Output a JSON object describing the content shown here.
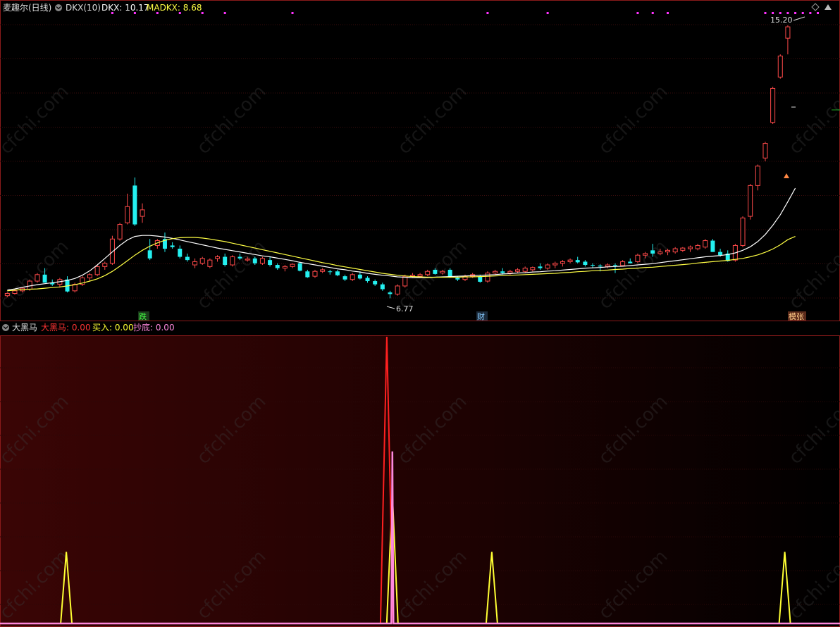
{
  "colors": {
    "up": "#ff4a4a",
    "down": "#24f0f0",
    "ma1": "#ffffff",
    "ma2": "#ffff44",
    "dahema": "#ff2020",
    "buy": "#ffff33",
    "chaodi": "#ff88dd",
    "dots": "#ff33ff",
    "bg_top": "#000000",
    "frame": "#8b1a1a",
    "grid": "#3a0d0d",
    "label": "#cccccc"
  },
  "header": {
    "stock_name": "麦趣尔(日线)",
    "indicator": "DKX(10)",
    "dkx_label": "DKX: 10.17",
    "madkx_label": "MADKX: 8.68"
  },
  "lower_header": {
    "name": "大黑马",
    "v1": "大黑马: 0.00",
    "v2": "买入: 0.00",
    "v3": "抄底: 0.00"
  },
  "annotations": {
    "high": "15.20",
    "low": "6.77",
    "tag1": "跌",
    "tag2": "财",
    "tag3": "模张"
  },
  "chart_data": [
    {
      "type": "candlestick",
      "ylim": [
        6.3,
        15.5
      ],
      "candles": [
        [
          6.85,
          6.95,
          6.8,
          6.92
        ],
        [
          6.92,
          7.05,
          6.88,
          7.0
        ],
        [
          7.0,
          7.1,
          6.95,
          7.08
        ],
        [
          7.05,
          7.35,
          7.0,
          7.3
        ],
        [
          7.3,
          7.55,
          7.25,
          7.5
        ],
        [
          7.5,
          7.7,
          7.4,
          7.25
        ],
        [
          7.25,
          7.35,
          7.15,
          7.2
        ],
        [
          7.2,
          7.4,
          7.1,
          7.35
        ],
        [
          7.35,
          7.45,
          6.95,
          6.98
        ],
        [
          7.0,
          7.25,
          6.95,
          7.2
        ],
        [
          7.2,
          7.45,
          7.15,
          7.4
        ],
        [
          7.4,
          7.55,
          7.3,
          7.5
        ],
        [
          7.5,
          7.8,
          7.45,
          7.75
        ],
        [
          7.75,
          7.9,
          7.65,
          7.85
        ],
        [
          7.85,
          8.7,
          7.8,
          8.6
        ],
        [
          8.6,
          9.1,
          8.55,
          9.05
        ],
        [
          9.1,
          10.0,
          9.05,
          9.6
        ],
        [
          10.25,
          10.5,
          9.0,
          9.05
        ],
        [
          9.3,
          9.7,
          9.1,
          9.5
        ],
        [
          8.25,
          8.6,
          7.95,
          8.0
        ],
        [
          8.4,
          8.6,
          8.3,
          8.55
        ],
        [
          8.6,
          8.8,
          8.2,
          8.3
        ],
        [
          8.4,
          8.5,
          8.3,
          8.35
        ],
        [
          8.3,
          8.4,
          8.0,
          8.05
        ],
        [
          8.05,
          8.15,
          7.9,
          7.95
        ],
        [
          7.8,
          8.0,
          7.7,
          7.9
        ],
        [
          7.85,
          8.05,
          7.8,
          8.0
        ],
        [
          7.75,
          8.0,
          7.7,
          7.95
        ],
        [
          8.0,
          8.1,
          7.9,
          8.05
        ],
        [
          8.05,
          8.15,
          7.75,
          7.8
        ],
        [
          7.8,
          8.1,
          7.75,
          8.05
        ],
        [
          8.05,
          8.15,
          7.95,
          8.0
        ],
        [
          7.95,
          8.05,
          7.9,
          7.98
        ],
        [
          8.0,
          8.05,
          7.8,
          7.85
        ],
        [
          7.85,
          8.05,
          7.8,
          8.0
        ],
        [
          7.95,
          8.05,
          7.75,
          7.8
        ],
        [
          7.8,
          7.85,
          7.65,
          7.7
        ],
        [
          7.7,
          7.8,
          7.6,
          7.75
        ],
        [
          7.75,
          7.85,
          7.7,
          7.82
        ],
        [
          7.85,
          7.9,
          7.6,
          7.62
        ],
        [
          7.6,
          7.65,
          7.4,
          7.42
        ],
        [
          7.45,
          7.65,
          7.4,
          7.6
        ],
        [
          7.6,
          7.7,
          7.55,
          7.65
        ],
        [
          7.6,
          7.65,
          7.5,
          7.58
        ],
        [
          7.6,
          7.65,
          7.45,
          7.48
        ],
        [
          7.45,
          7.5,
          7.3,
          7.35
        ],
        [
          7.35,
          7.55,
          7.3,
          7.5
        ],
        [
          7.5,
          7.6,
          7.35,
          7.38
        ],
        [
          7.4,
          7.45,
          7.25,
          7.3
        ],
        [
          7.3,
          7.35,
          7.15,
          7.2
        ],
        [
          7.2,
          7.25,
          7.0,
          7.05
        ],
        [
          6.95,
          7.0,
          6.77,
          6.9
        ],
        [
          6.9,
          7.2,
          6.85,
          7.15
        ],
        [
          7.15,
          7.5,
          7.1,
          7.45
        ],
        [
          7.45,
          7.55,
          7.4,
          7.48
        ],
        [
          7.45,
          7.55,
          7.4,
          7.5
        ],
        [
          7.5,
          7.65,
          7.45,
          7.6
        ],
        [
          7.65,
          7.7,
          7.5,
          7.52
        ],
        [
          7.55,
          7.65,
          7.5,
          7.6
        ],
        [
          7.65,
          7.7,
          7.4,
          7.42
        ],
        [
          7.4,
          7.45,
          7.3,
          7.35
        ],
        [
          7.35,
          7.5,
          7.3,
          7.45
        ],
        [
          7.45,
          7.55,
          7.4,
          7.5
        ],
        [
          7.45,
          7.5,
          7.25,
          7.28
        ],
        [
          7.3,
          7.6,
          7.25,
          7.55
        ],
        [
          7.55,
          7.65,
          7.5,
          7.6
        ],
        [
          7.6,
          7.7,
          7.5,
          7.55
        ],
        [
          7.55,
          7.65,
          7.5,
          7.6
        ],
        [
          7.6,
          7.7,
          7.55,
          7.65
        ],
        [
          7.6,
          7.75,
          7.55,
          7.7
        ],
        [
          7.65,
          7.75,
          7.6,
          7.72
        ],
        [
          7.75,
          7.85,
          7.65,
          7.7
        ],
        [
          7.7,
          7.85,
          7.65,
          7.8
        ],
        [
          7.8,
          7.9,
          7.7,
          7.85
        ],
        [
          7.85,
          7.95,
          7.75,
          7.9
        ],
        [
          7.9,
          8.0,
          7.85,
          7.95
        ],
        [
          7.95,
          8.05,
          7.85,
          7.88
        ],
        [
          7.9,
          7.95,
          7.75,
          7.8
        ],
        [
          7.8,
          7.85,
          7.7,
          7.78
        ],
        [
          7.78,
          7.82,
          7.6,
          7.75
        ],
        [
          7.75,
          7.85,
          7.7,
          7.8
        ],
        [
          7.8,
          7.85,
          7.55,
          7.78
        ],
        [
          7.78,
          7.95,
          7.75,
          7.9
        ],
        [
          7.9,
          8.0,
          7.85,
          7.85
        ],
        [
          7.9,
          8.15,
          7.85,
          8.1
        ],
        [
          8.1,
          8.2,
          8.0,
          8.15
        ],
        [
          8.25,
          8.45,
          8.05,
          8.15
        ],
        [
          8.15,
          8.3,
          8.1,
          8.2
        ],
        [
          8.2,
          8.3,
          8.1,
          8.25
        ],
        [
          8.2,
          8.35,
          8.15,
          8.3
        ],
        [
          8.25,
          8.35,
          8.2,
          8.32
        ],
        [
          8.3,
          8.4,
          8.2,
          8.35
        ],
        [
          8.3,
          8.45,
          8.25,
          8.4
        ],
        [
          8.35,
          8.6,
          8.3,
          8.55
        ],
        [
          8.55,
          8.6,
          8.2,
          8.2
        ],
        [
          8.2,
          8.3,
          8.05,
          8.1
        ],
        [
          8.15,
          8.25,
          7.9,
          7.92
        ],
        [
          7.95,
          8.45,
          7.9,
          8.4
        ],
        [
          8.4,
          9.3,
          8.35,
          9.25
        ],
        [
          9.3,
          10.3,
          9.2,
          10.25
        ],
        [
          10.25,
          10.9,
          10.1,
          10.85
        ],
        [
          11.1,
          11.6,
          11.0,
          11.55
        ],
        [
          12.2,
          13.3,
          12.15,
          13.25
        ],
        [
          13.6,
          14.3,
          13.55,
          14.25
        ],
        [
          14.8,
          15.2,
          14.3,
          15.15
        ]
      ],
      "ma1": [
        7.02,
        7.06,
        7.11,
        7.15,
        7.19,
        7.22,
        7.25,
        7.28,
        7.32,
        7.38,
        7.48,
        7.62,
        7.8,
        8.0,
        8.2,
        8.4,
        8.57,
        8.68,
        8.71,
        8.71,
        8.69,
        8.66,
        8.62,
        8.57,
        8.52,
        8.47,
        8.42,
        8.37,
        8.32,
        8.28,
        8.24,
        8.2,
        8.16,
        8.12,
        8.08,
        8.05,
        8.01,
        7.97,
        7.93,
        7.88,
        7.84,
        7.8,
        7.76,
        7.72,
        7.68,
        7.65,
        7.61,
        7.58,
        7.54,
        7.51,
        7.48,
        7.46,
        7.43,
        7.42,
        7.41,
        7.41,
        7.41,
        7.42,
        7.43,
        7.44,
        7.45,
        7.46,
        7.47,
        7.48,
        7.49,
        7.5,
        7.52,
        7.53,
        7.55,
        7.56,
        7.58,
        7.59,
        7.61,
        7.62,
        7.64,
        7.66,
        7.68,
        7.7,
        7.71,
        7.72,
        7.74,
        7.75,
        7.76,
        7.78,
        7.8,
        7.82,
        7.84,
        7.87,
        7.9,
        7.93,
        7.96,
        7.99,
        8.02,
        8.05,
        8.07,
        8.09,
        8.12,
        8.17,
        8.25,
        8.36,
        8.52,
        8.74,
        9.02,
        9.35,
        9.75,
        10.17
      ],
      "ma2": [
        7.0,
        7.02,
        7.04,
        7.05,
        7.06,
        7.08,
        7.1,
        7.12,
        7.15,
        7.19,
        7.24,
        7.3,
        7.37,
        7.47,
        7.6,
        7.76,
        7.93,
        8.1,
        8.25,
        8.38,
        8.48,
        8.56,
        8.61,
        8.64,
        8.65,
        8.65,
        8.63,
        8.6,
        8.56,
        8.52,
        8.47,
        8.42,
        8.37,
        8.32,
        8.27,
        8.22,
        8.17,
        8.12,
        8.07,
        8.02,
        7.97,
        7.92,
        7.87,
        7.83,
        7.78,
        7.74,
        7.7,
        7.66,
        7.62,
        7.58,
        7.54,
        7.51,
        7.48,
        7.46,
        7.44,
        7.43,
        7.42,
        7.42,
        7.42,
        7.42,
        7.42,
        7.43,
        7.43,
        7.44,
        7.45,
        7.46,
        7.47,
        7.48,
        7.49,
        7.5,
        7.51,
        7.52,
        7.53,
        7.54,
        7.56,
        7.57,
        7.59,
        7.6,
        7.62,
        7.63,
        7.64,
        7.66,
        7.67,
        7.69,
        7.7,
        7.72,
        7.73,
        7.75,
        7.77,
        7.79,
        7.81,
        7.83,
        7.86,
        7.88,
        7.9,
        7.92,
        7.94,
        7.97,
        8.0,
        8.05,
        8.11,
        8.19,
        8.29,
        8.42,
        8.58,
        8.68
      ]
    },
    {
      "type": "line",
      "series": [
        {
          "name": "大黑马",
          "spikes": [
            [
              70,
              1.0
            ]
          ]
        },
        {
          "name": "买入",
          "spikes": [
            [
              12,
              0.25
            ],
            [
              71,
              0.45
            ],
            [
              89,
              0.25
            ],
            [
              142,
              0.25
            ]
          ]
        },
        {
          "name": "抄底",
          "spikes": [
            [
              71,
              0.6
            ]
          ]
        }
      ],
      "x_count": 152
    }
  ]
}
